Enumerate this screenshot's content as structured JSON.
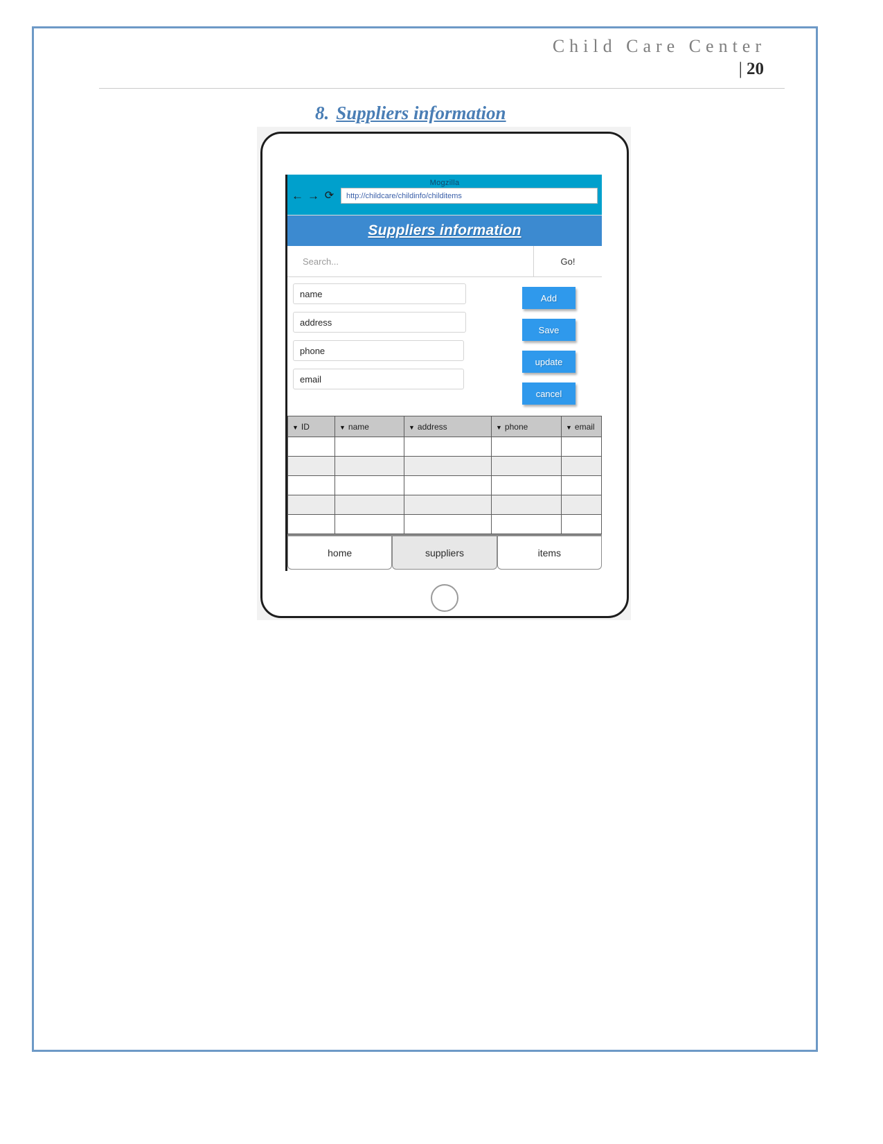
{
  "document": {
    "header_title": "Child Care Center",
    "page_number_bar": "|",
    "page_number": "20",
    "border_color": "#6d99c6"
  },
  "section": {
    "number": "8.",
    "title": "Suppliers information",
    "color": "#4a7eb5"
  },
  "browser": {
    "name": "Mogzilla",
    "chrome_color": "#00a0cc",
    "back_icon": "←",
    "forward_icon": "→",
    "reload_icon": "⟳",
    "url": "http://childcare/childinfo/childitems"
  },
  "app": {
    "title": "Suppliers information",
    "header_color": "#3c8ad0",
    "search": {
      "placeholder": "Search...",
      "value": "",
      "go_label": "Go!"
    },
    "form": {
      "fields": [
        {
          "name": "name-field",
          "value": "name"
        },
        {
          "name": "address-field",
          "value": "address"
        },
        {
          "name": "phone-field",
          "value": "phone"
        },
        {
          "name": "email-field",
          "value": "email"
        }
      ],
      "buttons": [
        {
          "label": "Add"
        },
        {
          "label": "Save"
        },
        {
          "label": "update"
        },
        {
          "label": "cancel"
        }
      ],
      "button_color": "#2f99ec"
    },
    "table": {
      "caret": "▼",
      "columns": [
        "ID",
        "name",
        "address",
        "phone",
        "email"
      ],
      "rows": [
        [
          "",
          "",
          "",
          "",
          ""
        ],
        [
          "",
          "",
          "",
          "",
          ""
        ],
        [
          "",
          "",
          "",
          "",
          ""
        ],
        [
          "",
          "",
          "",
          "",
          ""
        ],
        [
          "",
          "",
          "",
          "",
          ""
        ]
      ]
    },
    "tabs": [
      {
        "label": "home",
        "active": false
      },
      {
        "label": "suppliers",
        "active": true
      },
      {
        "label": "items",
        "active": false
      }
    ]
  }
}
